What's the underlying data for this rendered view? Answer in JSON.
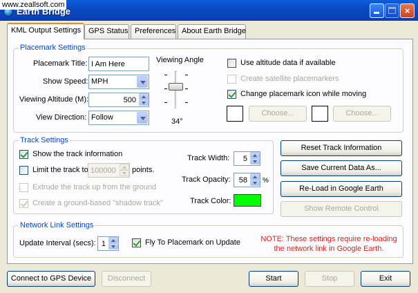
{
  "window": {
    "watermark": "www.zeallsoft.com",
    "title": "Earth Bridge",
    "minimize": "minimize",
    "maximize": "maximize",
    "close": "×"
  },
  "tabs": [
    {
      "label": "KML Output Settings",
      "active": true
    },
    {
      "label": "GPS Status"
    },
    {
      "label": "Preferences"
    },
    {
      "label": "About Earth Bridge"
    }
  ],
  "placemark": {
    "legend": "Placemark Settings",
    "title_label": "Placemark Title:",
    "title_value": "I Am Here",
    "speed_label": "Show Speed:",
    "speed_value": "MPH",
    "altitude_label": "Viewing Altitude (M):",
    "altitude_value": "500",
    "direction_label": "View Direction:",
    "direction_value": "Follow",
    "angle_label": "Viewing Angle",
    "angle_value": "34°",
    "use_altitude_label": "Use altitude data if available",
    "satellite_label": "Create satellite placemarkers",
    "change_icon_label": "Change placemark icon while moving",
    "choose1": "Choose...",
    "choose2": "Choose..."
  },
  "track": {
    "legend": "Track Settings",
    "show_track_label": "Show the track information",
    "limit_label": "Limit the track to",
    "limit_value": "100000",
    "points_label": "points.",
    "extrude_label": "Extrude the track up from the ground",
    "shadow_label": "Create a ground-based \"shadow track\"",
    "width_label": "Track Width:",
    "width_value": "5",
    "opacity_label": "Track Opacity:",
    "opacity_value": "58",
    "opacity_unit": "%",
    "color_label": "Track Color:",
    "color_hex": "#00ff00"
  },
  "actions": {
    "reset": "Reset Track Information",
    "save": "Save Current Data As...",
    "reload": "Re-Load in Google Earth",
    "remote": "Show Remote Control"
  },
  "network": {
    "legend": "Network Link Settings",
    "interval_label": "Update Interval (secs):",
    "interval_value": "1",
    "fly_label": "Fly To Placemark on Update",
    "note_line1": "NOTE: These settings require re-loading",
    "note_line2": "the network link in Google Earth."
  },
  "bottom": {
    "connect": "Connect to GPS Device",
    "disconnect": "Disconnect",
    "start": "Start",
    "stop": "Stop",
    "exit": "Exit"
  },
  "icons": [
    "app-globe-icon",
    "minimize-icon",
    "maximize-icon",
    "close-icon",
    "chevron-down-icon",
    "spin-up-icon",
    "spin-down-icon",
    "checkmark-icon"
  ],
  "colors": {
    "titlebar": "#0b48c2",
    "legend": "#0046d5",
    "note": "#e0201b",
    "track_color": "#00ff00"
  }
}
